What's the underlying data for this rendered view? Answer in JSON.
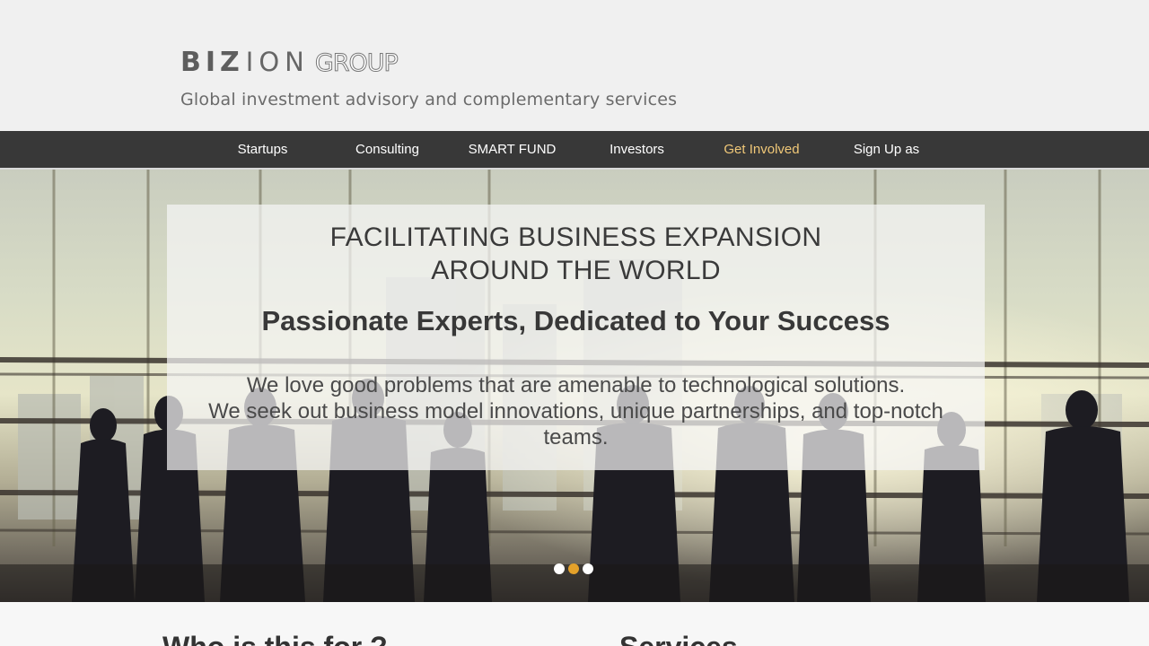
{
  "brand": {
    "logo_part1": "BIZ",
    "logo_part2": "ION",
    "logo_part3": "GROUP",
    "tagline": "Global investment advisory and complementary services"
  },
  "nav": {
    "items": [
      {
        "label": "Startups"
      },
      {
        "label": "Consulting"
      },
      {
        "label": "SMART FUND"
      },
      {
        "label": "Investors"
      },
      {
        "label": "Get Involved",
        "active": true
      },
      {
        "label": "Sign Up as"
      }
    ]
  },
  "hero": {
    "heading_line1": "FACILITATING BUSINESS EXPANSION",
    "heading_line2": "AROUND THE WORLD",
    "subheading": "Passionate Experts, Dedicated to Your Success",
    "body_line1": "We love good problems that are amenable to technological solutions.",
    "body_line2": "We seek out business model innovations, unique partnerships, and top-notch teams.",
    "slides": 3,
    "active_slide": 2
  },
  "sections": {
    "left_title": "Who is this for ?",
    "right_title": "Services"
  },
  "colors": {
    "nav_bg": "#383838",
    "nav_active": "#f0c878",
    "dot_active": "#e4a12a"
  }
}
